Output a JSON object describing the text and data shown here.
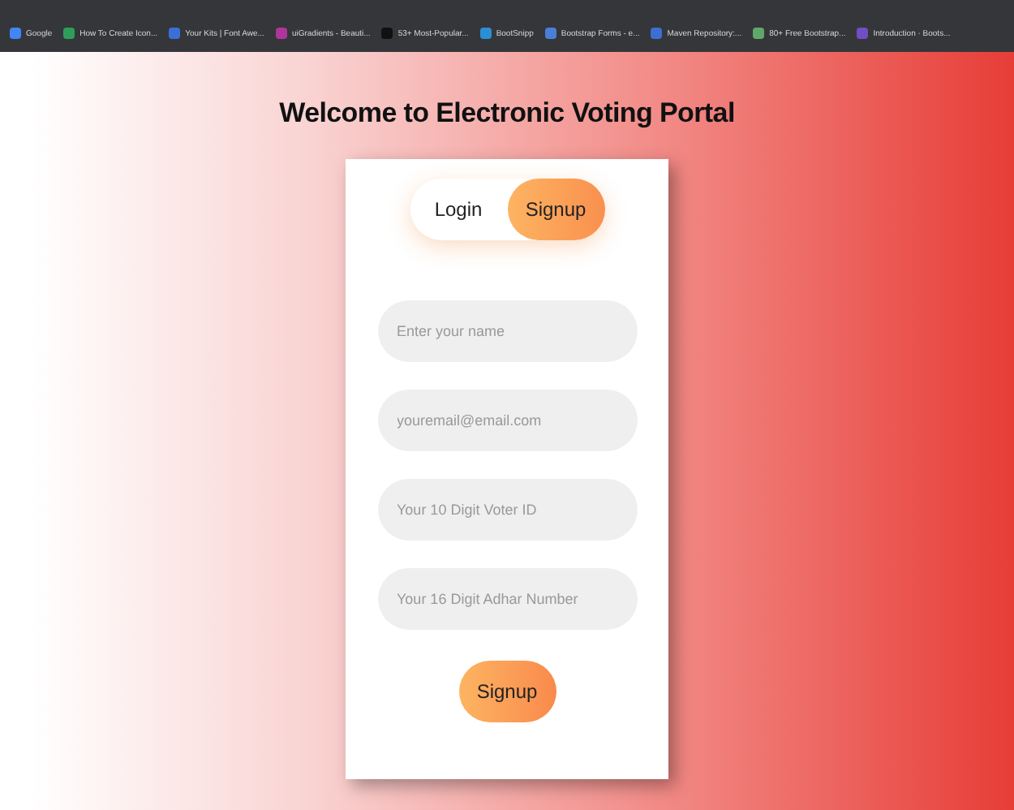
{
  "bookmarks": [
    {
      "label": "Google",
      "color": "#4285f4"
    },
    {
      "label": "How To Create Icon...",
      "color": "#2e9d5b"
    },
    {
      "label": "Your Kits | Font Awe...",
      "color": "#3b6fd8"
    },
    {
      "label": "uiGradients - Beauti...",
      "color": "#b0359b"
    },
    {
      "label": "53+ Most-Popular...",
      "color": "#111111"
    },
    {
      "label": "BootSnipp",
      "color": "#2b8fd6"
    },
    {
      "label": "Bootstrap Forms - e...",
      "color": "#4a7fd8"
    },
    {
      "label": "Maven Repository:...",
      "color": "#3c6fd1"
    },
    {
      "label": "80+ Free Bootstrap...",
      "color": "#5fa86a"
    },
    {
      "label": "Introduction · Boots...",
      "color": "#6f4fc2"
    }
  ],
  "heading": "Welcome to Electronic Voting Portal",
  "tabs": [
    {
      "label": "Login",
      "selected": false
    },
    {
      "label": "Signup",
      "selected": true
    }
  ],
  "fields": [
    {
      "placeholder": "Enter your name"
    },
    {
      "placeholder": "youremail@email.com"
    },
    {
      "placeholder": "Your 10 Digit Voter ID"
    },
    {
      "placeholder": "Your 16 Digit Adhar Number"
    }
  ],
  "submit": "Signup"
}
